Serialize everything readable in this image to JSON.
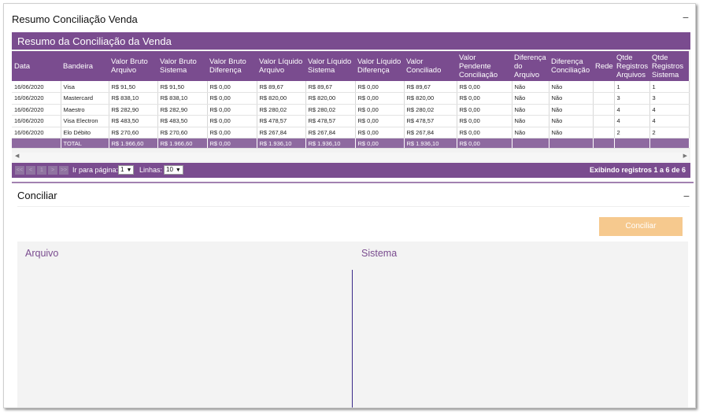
{
  "resumo_panel": {
    "title": "Resumo Conciliação Venda",
    "collapse_symbol": "−"
  },
  "table": {
    "title": "Resumo da Conciliação da Venda",
    "headers": [
      "Data",
      "Bandeira",
      "Valor Bruto Arquivo",
      "Valor Bruto Sistema",
      "Valor Bruto Diferença",
      "Valor Líquido Arquivo",
      "Valor Líquido Sistema",
      "Valor Líquido Diferença",
      "Valor Conciliado",
      "Valor Pendente Conciliação",
      "Diferença do Arquivo",
      "Diferença Conciliação",
      "Rede",
      "Qtde Registros Arquivos",
      "Qtde Registros Sistema"
    ],
    "rows": [
      [
        "16/06/2020",
        "Visa",
        "R$ 91,50",
        "R$ 91,50",
        "R$ 0,00",
        "R$ 89,67",
        "R$ 89,67",
        "R$ 0,00",
        "R$ 89,67",
        "R$ 0,00",
        "Não",
        "Não",
        "",
        "1",
        "1"
      ],
      [
        "16/06/2020",
        "Mastercard",
        "R$ 838,10",
        "R$ 838,10",
        "R$ 0,00",
        "R$ 820,00",
        "R$ 820,00",
        "R$ 0,00",
        "R$ 820,00",
        "R$ 0,00",
        "Não",
        "Não",
        "",
        "3",
        "3"
      ],
      [
        "16/06/2020",
        "Maestro",
        "R$ 282,90",
        "R$ 282,90",
        "R$ 0,00",
        "R$ 280,02",
        "R$ 280,02",
        "R$ 0,00",
        "R$ 280,02",
        "R$ 0,00",
        "Não",
        "Não",
        "",
        "4",
        "4"
      ],
      [
        "16/06/2020",
        "Visa Electron",
        "R$ 483,50",
        "R$ 483,50",
        "R$ 0,00",
        "R$ 478,57",
        "R$ 478,57",
        "R$ 0,00",
        "R$ 478,57",
        "R$ 0,00",
        "Não",
        "Não",
        "",
        "4",
        "4"
      ],
      [
        "16/06/2020",
        "Elo Débito",
        "R$ 270,60",
        "R$ 270,60",
        "R$ 0,00",
        "R$ 267,84",
        "R$ 267,84",
        "R$ 0,00",
        "R$ 267,84",
        "R$ 0,00",
        "Não",
        "Não",
        "",
        "2",
        "2"
      ]
    ],
    "total_row": [
      "",
      "TOTAL",
      "R$ 1.966,60",
      "R$ 1.966,60",
      "R$ 0,00",
      "R$ 1.936,10",
      "R$ 1.936,10",
      "R$ 0,00",
      "R$ 1.936,10",
      "R$ 0,00",
      "",
      "",
      "",
      "",
      ""
    ]
  },
  "scrollbar": {
    "left_arrow": "◀",
    "right_arrow": "▶"
  },
  "pager": {
    "first": "<<",
    "prev": "<",
    "page": "1",
    "next": ">",
    "last": ">>",
    "goto_label": "Ir para página:",
    "goto_value": "1",
    "rows_label": "Linhas:",
    "rows_value": "10",
    "info": "Exibindo registros 1 a 6 de 6"
  },
  "conciliar_panel": {
    "title": "Conciliar",
    "collapse_symbol": "−",
    "button_label": "Conciliar",
    "left_title": "Arquivo",
    "right_title": "Sistema"
  },
  "colors": {
    "accent_purple": "#7a4c8f",
    "button_orange": "#f6c98e"
  }
}
